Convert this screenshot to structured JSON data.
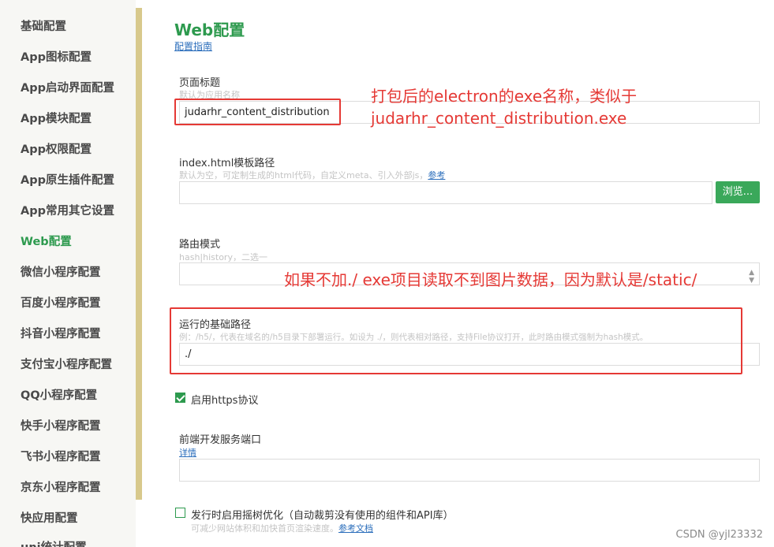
{
  "sidebar": {
    "items": [
      {
        "label": "基础配置"
      },
      {
        "label": "App图标配置"
      },
      {
        "label": "App启动界面配置"
      },
      {
        "label": "App模块配置"
      },
      {
        "label": "App权限配置"
      },
      {
        "label": "App原生插件配置"
      },
      {
        "label": "App常用其它设置"
      },
      {
        "label": "Web配置",
        "active": true
      },
      {
        "label": "微信小程序配置"
      },
      {
        "label": "百度小程序配置"
      },
      {
        "label": "抖音小程序配置"
      },
      {
        "label": "支付宝小程序配置"
      },
      {
        "label": "QQ小程序配置"
      },
      {
        "label": "快手小程序配置"
      },
      {
        "label": "飞书小程序配置"
      },
      {
        "label": "京东小程序配置"
      },
      {
        "label": "快应用配置"
      },
      {
        "label": "uni统计配置"
      }
    ]
  },
  "main": {
    "title": "Web配置",
    "guide_link": "配置指南",
    "page_title_field": {
      "label": "页面标题",
      "hint": "默认为应用名称",
      "value": "judarhr_content_distribution"
    },
    "template_field": {
      "label": "index.html模板路径",
      "hint": "默认为空，可定制生成的html代码，自定义meta、引入外部js，",
      "hint_link": "参考",
      "value": "",
      "browse_label": "浏览..."
    },
    "router_field": {
      "label": "路由模式",
      "hint": "hash|history，二选一",
      "value": ""
    },
    "base_path_field": {
      "label": "运行的基础路径",
      "hint": "例：/h5/，代表在域名的/h5目录下部署运行。如设为 ./，则代表相对路径，支持File协议打开，此时路由模式强制为hash模式。",
      "value": "./"
    },
    "https_option": {
      "label": "启用https协议",
      "checked": true
    },
    "dev_port_field": {
      "label": "前端开发服务端口",
      "link": "详情",
      "value": ""
    },
    "treeshake_option": {
      "label": "发行时启用摇树优化（自动裁剪没有使用的组件和API库）",
      "hint": "可减少网站体积和加快首页渲染速度。",
      "hint_link": "参考文档",
      "checked": false
    }
  },
  "annotations": {
    "note1_line1": "打包后的electron的exe名称，类似于",
    "note1_line2": "judarhr_content_distribution.exe",
    "note2": "如果不加./ exe项目读取不到图片数据，因为默认是/static/"
  },
  "watermark": "CSDN @yjl23332",
  "colors": {
    "accent_green": "#2d9a4e",
    "annotation_red": "#e53935",
    "link_blue": "#2a6dbb",
    "sidebar_bar": "#d8c98c"
  }
}
